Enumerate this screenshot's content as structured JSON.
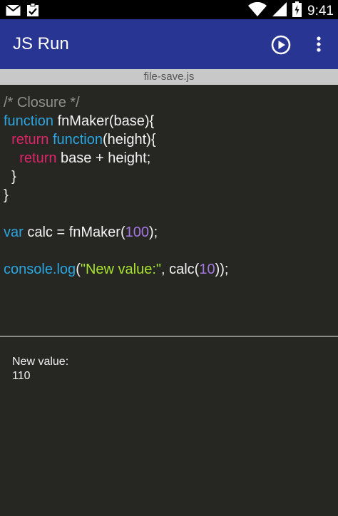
{
  "status_bar": {
    "time": "9:41",
    "icons": [
      "mail-icon",
      "clipboard-icon",
      "wifi-icon",
      "signal-icon",
      "battery-icon"
    ]
  },
  "app_bar": {
    "title": "JS Run",
    "background": "#283593",
    "actions": [
      "play-icon",
      "more-vert-icon"
    ]
  },
  "file_tab": {
    "name": "file-save.js"
  },
  "editor": {
    "lines": [
      [
        {
          "t": "/* Closure */",
          "c": "comment"
        }
      ],
      [
        {
          "t": "function",
          "c": "keyword"
        },
        {
          "t": " fnMaker(base){",
          "c": "plain"
        }
      ],
      [
        {
          "t": "  ",
          "c": "plain"
        },
        {
          "t": "return",
          "c": "return"
        },
        {
          "t": " ",
          "c": "plain"
        },
        {
          "t": "function",
          "c": "keyword"
        },
        {
          "t": "(height){",
          "c": "plain"
        }
      ],
      [
        {
          "t": "    ",
          "c": "plain"
        },
        {
          "t": "return",
          "c": "return"
        },
        {
          "t": " base + height;",
          "c": "plain"
        }
      ],
      [
        {
          "t": "  }",
          "c": "plain"
        }
      ],
      [
        {
          "t": "}",
          "c": "plain"
        }
      ],
      [],
      [
        {
          "t": "var",
          "c": "keyword"
        },
        {
          "t": " calc = fnMaker(",
          "c": "plain"
        },
        {
          "t": "100",
          "c": "number"
        },
        {
          "t": ");",
          "c": "plain"
        }
      ],
      [],
      [
        {
          "t": "console.log",
          "c": "keyword"
        },
        {
          "t": "(",
          "c": "plain"
        },
        {
          "t": "\"New value:\"",
          "c": "string"
        },
        {
          "t": ", calc(",
          "c": "plain"
        },
        {
          "t": "10",
          "c": "number"
        },
        {
          "t": "));",
          "c": "plain"
        }
      ]
    ],
    "colors": {
      "comment": "#8f908a",
      "keyword": "#2aa6e0",
      "return": "#e0246a",
      "number": "#a477e0",
      "string": "#a6e22e",
      "plain": "#f2f2f2"
    }
  },
  "output": {
    "lines": [
      "New value:",
      "110"
    ]
  }
}
